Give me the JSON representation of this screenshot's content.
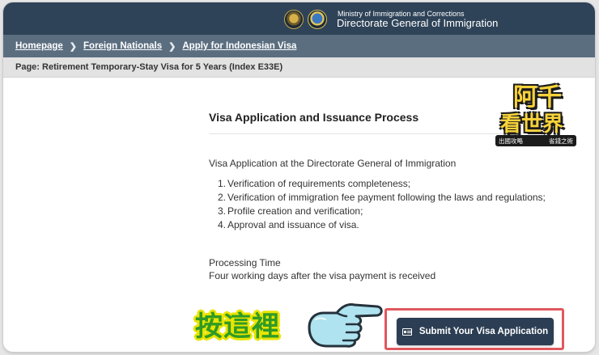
{
  "header": {
    "ministry": "Ministry of Immigration and Corrections",
    "directorate": "Directorate General of Immigration"
  },
  "breadcrumb": {
    "items": [
      "Homepage",
      "Foreign Nationals",
      "Apply for Indonesian Visa"
    ],
    "separator_icon": "chevron-right-icon"
  },
  "page_label": "Page: Retirement Temporary-Stay Visa for 5 Years (Index E33E)",
  "content": {
    "heading": "Visa Application and Issuance Process",
    "intro": "Visa Application at the Directorate General of Immigration",
    "steps": [
      {
        "num": "1.",
        "text": "Verification of requirements completeness;"
      },
      {
        "num": "2.",
        "text": "Verification of immigration fee payment following the laws and regulations;"
      },
      {
        "num": "3.",
        "text": "Profile creation and verification;"
      },
      {
        "num": "4.",
        "text": "Approval and issuance of visa."
      }
    ],
    "processing_title": "Processing Time",
    "processing_text": "Four working days after the visa payment is received"
  },
  "submit_button": {
    "label": "Submit Your Visa Application",
    "icon": "id-card-icon"
  },
  "annotation": {
    "press_here": "按這裡",
    "pointer_icon": "pointing-hand-icon",
    "highlight_color": "#e0585d"
  },
  "watermark": {
    "line1": "阿千",
    "line2": "看世界",
    "sub_left": "出國攻略",
    "sub_right": "省錢之術"
  },
  "colors": {
    "topbar": "#2f4358",
    "breadcrumb_bar": "#5b6e80",
    "button": "#2c3e53"
  }
}
